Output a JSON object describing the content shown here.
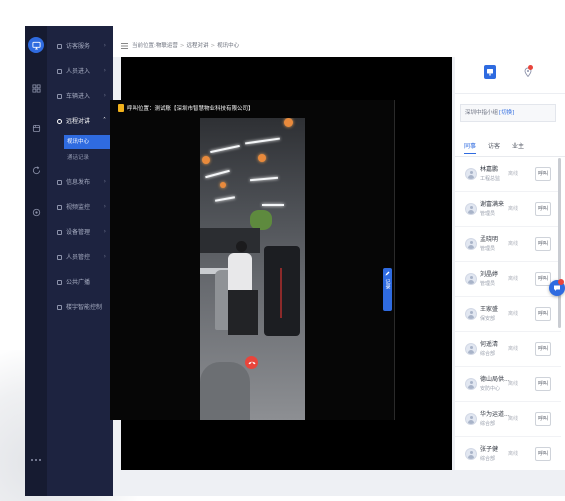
{
  "iconbar": {
    "items": [
      {
        "icon": "monitor-icon",
        "active": true
      },
      {
        "icon": "grid-icon"
      },
      {
        "icon": "database-icon"
      },
      {
        "icon": "refresh-icon"
      },
      {
        "icon": "settings-icon"
      }
    ],
    "more_icon": "more-icon"
  },
  "sidebar": {
    "items": [
      {
        "label": "访客服务",
        "icon": "visitor-icon",
        "arrow": "›"
      },
      {
        "label": "人员进入",
        "icon": "person-entry-icon",
        "arrow": "›"
      },
      {
        "label": "车辆进入",
        "icon": "vehicle-entry-icon",
        "arrow": "›"
      },
      {
        "label": "远程对讲",
        "icon": "intercom-icon",
        "arrow": "˄",
        "expanded": true,
        "children": [
          {
            "label": "视讯中心",
            "active": true
          },
          {
            "label": "通话记录"
          }
        ]
      },
      {
        "label": "信息发布",
        "icon": "publish-icon",
        "arrow": "›"
      },
      {
        "label": "视频监控",
        "icon": "camera-icon",
        "arrow": "›"
      },
      {
        "label": "设备管理",
        "icon": "device-icon",
        "arrow": "›"
      },
      {
        "label": "人员管控",
        "icon": "people-control-icon",
        "arrow": "›"
      },
      {
        "label": "公共广播",
        "icon": "broadcast-icon"
      },
      {
        "label": "楼宇智能控制",
        "icon": "building-icon"
      }
    ]
  },
  "breadcrumb": {
    "menu_icon": "menu-icon",
    "prefix": "当前位置:",
    "path": [
      "物联运营",
      "远程对讲",
      "视讯中心"
    ],
    "separator": ">"
  },
  "call": {
    "title": "呼叫位置：测试账【深圳市智慧物业科技有限公司】",
    "caller_icon": "caller-icon",
    "hangup_icon": "hang-up-icon",
    "side_tool": {
      "icon": "pen-icon",
      "label": "记录"
    }
  },
  "right_panel": {
    "icons": [
      {
        "icon": "monitor-icon",
        "active": true
      },
      {
        "icon": "location-icon",
        "badge": true
      }
    ],
    "project": {
      "name": "深圳中指小组",
      "switch_label": "[切换]"
    },
    "tabs": [
      {
        "label": "同事",
        "active": true
      },
      {
        "label": "访客"
      },
      {
        "label": "业主"
      }
    ],
    "contacts": [
      {
        "name": "林嘉鹏",
        "role": "工程总监",
        "status": "离线",
        "action": "呼叫"
      },
      {
        "name": "谢富满来",
        "role": "管理员",
        "status": "离线",
        "action": "呼叫"
      },
      {
        "name": "孟晓明",
        "role": "管理员",
        "status": "离线",
        "action": "呼叫"
      },
      {
        "name": "刘晶婷",
        "role": "管理员",
        "status": "离线",
        "action": "呼叫"
      },
      {
        "name": "王家盛",
        "role": "保安部",
        "status": "离线",
        "action": "呼叫"
      },
      {
        "name": "何遥清",
        "role": "综合部",
        "status": "离线",
        "action": "呼叫"
      },
      {
        "name": "德山局供...",
        "role": "安防中心",
        "status": "离线",
        "action": "呼叫"
      },
      {
        "name": "华为运道...",
        "role": "综合部",
        "status": "离线",
        "action": "呼叫"
      },
      {
        "name": "张子健",
        "role": "综合部",
        "status": "离线",
        "action": "呼叫"
      }
    ]
  },
  "floating_button": {
    "icon": "chat-icon",
    "badge": true
  },
  "colors": {
    "accent": "#2f6be0",
    "sidebar_bg": "#1d2340",
    "iconbar_bg": "#161b31",
    "hangup": "#e8453c",
    "badge": "#e8453c",
    "caller_icon": "#f2b21c"
  }
}
